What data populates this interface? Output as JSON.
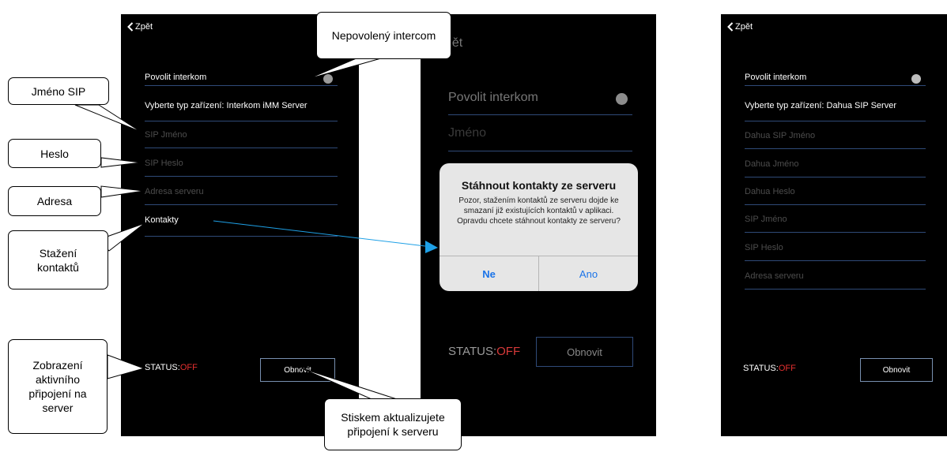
{
  "left_screen": {
    "back_label": "Zpět",
    "rows": [
      {
        "label": "Povolit interkom"
      },
      {
        "label": "Vyberte typ zařízení: Interkom iMM Server"
      },
      {
        "label": "SIP Jméno"
      },
      {
        "label": "SIP Heslo"
      },
      {
        "label": "Adresa serveru"
      },
      {
        "label": "Kontakty"
      }
    ],
    "status_label": "STATUS:",
    "status_value": "OFF",
    "refresh_button": "Obnovit"
  },
  "middle_screen": {
    "back_label": "pět",
    "rows": [
      {
        "label": "Povolit interkom"
      },
      {
        "label": "Jméno"
      }
    ],
    "status_label": "STATUS:",
    "status_value": "OFF",
    "refresh_button": "Obnovit",
    "dialog": {
      "title": "Stáhnout kontakty ze serveru",
      "message": "Pozor, stažením kontaktů ze serveru dojde ke smazaní již existujících kontaktů v aplikaci. Opravdu chcete stáhnout kontakty ze serveru?",
      "no_button": "Ne",
      "yes_button": "Ano"
    }
  },
  "right_screen": {
    "back_label": "Zpět",
    "rows": [
      {
        "label": "Povolit interkom"
      },
      {
        "label": "Vyberte typ zařízení: Dahua SIP Server"
      },
      {
        "label": "Dahua SIP Jméno"
      },
      {
        "label": "Dahua Jméno"
      },
      {
        "label": "Dahua Heslo"
      },
      {
        "label": "SIP Jméno"
      },
      {
        "label": "SIP Heslo"
      },
      {
        "label": "Adresa serveru"
      }
    ],
    "status_label": "STATUS:",
    "status_value": "OFF",
    "refresh_button": "Obnovit"
  },
  "callouts": {
    "nepovoleny": "Nepovolený intercom",
    "jmeno_sip": "Jméno SIP",
    "heslo": "Heslo",
    "adresa": "Adresa",
    "stazeni": "Stažení kontaktů",
    "zobrazeni": "Zobrazení aktivního připojení na server",
    "stiskem": "Stiskem aktualizujete připojení k serveru"
  },
  "colors": {
    "status_off": "#e53030",
    "divider": "#2f4a78",
    "dialog_button": "#1a73e8",
    "arrow": "#1ea0e6"
  }
}
